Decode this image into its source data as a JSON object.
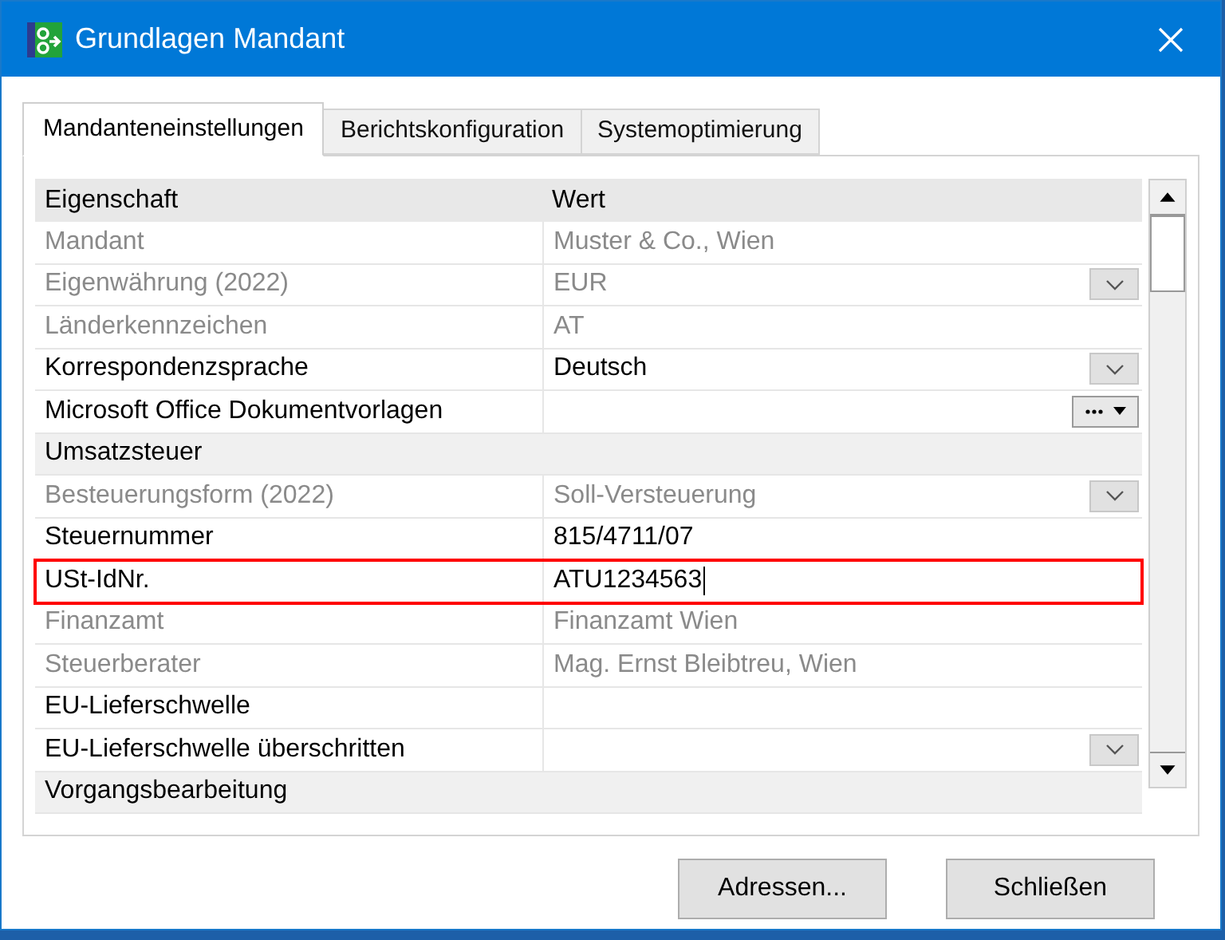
{
  "window": {
    "title": "Grundlagen Mandant"
  },
  "tabs": [
    {
      "label": "Mandanteneinstellungen",
      "selected": true
    },
    {
      "label": "Berichtskonfiguration",
      "selected": false
    },
    {
      "label": "Systemoptimierung",
      "selected": false
    }
  ],
  "grid": {
    "columns": [
      "Eigenschaft",
      "Wert"
    ],
    "rows": [
      {
        "kind": "property",
        "label": "Mandant",
        "value": "Muster & Co., Wien",
        "disabled": true
      },
      {
        "kind": "property",
        "label": "Eigenwährung (2022)",
        "value": "EUR",
        "disabled": true,
        "dropdown": true
      },
      {
        "kind": "property",
        "label": "Länderkennzeichen",
        "value": "AT",
        "disabled": true
      },
      {
        "kind": "property",
        "label": "Korrespondenzsprache",
        "value": "Deutsch",
        "disabled": false,
        "dropdown": true
      },
      {
        "kind": "property",
        "label": "Microsoft Office Dokumentvorlagen",
        "disabled": false,
        "browse_button": true
      },
      {
        "kind": "section",
        "label": "Umsatzsteuer"
      },
      {
        "kind": "property",
        "label": "Besteuerungsform (2022)",
        "value": "Soll-Versteuerung",
        "disabled": true,
        "dropdown": true
      },
      {
        "kind": "property",
        "label": "Steuernummer",
        "value": "815/4711/07",
        "disabled": false
      },
      {
        "kind": "property",
        "label": "USt-IdNr.",
        "value": "ATU1234563",
        "disabled": false,
        "editing": true,
        "highlighted": true
      },
      {
        "kind": "property",
        "label": "Finanzamt",
        "value": "Finanzamt Wien",
        "disabled": true
      },
      {
        "kind": "property",
        "label": "Steuerberater",
        "value": "Mag. Ernst Bleibtreu, Wien",
        "disabled": true
      },
      {
        "kind": "property",
        "label": "EU-Lieferschwelle",
        "disabled": false
      },
      {
        "kind": "property",
        "label": "EU-Lieferschwelle überschritten",
        "disabled": false,
        "dropdown": true
      },
      {
        "kind": "section",
        "label": "Vorgangsbearbeitung"
      }
    ]
  },
  "buttons": [
    "Adressen...",
    "Schließen"
  ]
}
